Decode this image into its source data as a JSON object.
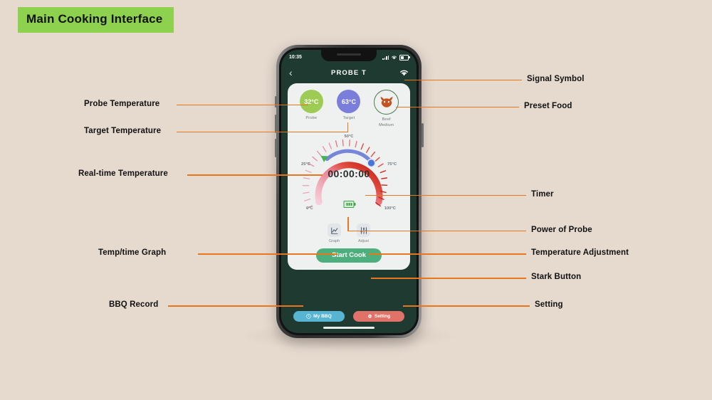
{
  "banner": {
    "title": "Main Cooking Interface",
    "bg": "#8ed14f"
  },
  "phone": {
    "status": {
      "time": "10:35",
      "signal_icon": "cellular-bars-icon",
      "wifi_icon": "wifi-icon",
      "battery_icon": "battery-icon"
    },
    "nav": {
      "back_icon": "chevron-left-icon",
      "title": "PROBE T",
      "wifi_icon": "wifi-icon"
    },
    "readouts": [
      {
        "value": "32°C",
        "label": "Probe",
        "color": "#9dcb53",
        "name": "probe-temperature"
      },
      {
        "value": "63°C",
        "label": "Target",
        "color": "#7b7ddb",
        "name": "target-temperature"
      },
      {
        "value": "",
        "label": "Beef\nMedium",
        "label_line1": "Beef",
        "label_line2": "Medium",
        "icon": "bull-head-icon",
        "color": "#c2521f",
        "name": "preset-food"
      }
    ],
    "gauge": {
      "timer": "00:00:00",
      "ticks": [
        "0°C",
        "25°C",
        "50°C",
        "75°C",
        "100°C"
      ],
      "min": 0,
      "max": 100,
      "unit": "°C",
      "probe_marker_value": 32,
      "target_marker_value": 63,
      "probe_marker_color": "#4caf50",
      "target_marker_color": "#4a74d8",
      "arc_start_color": "#f3c6d3",
      "arc_end_color": "#d42d20",
      "probe_battery_icon": "battery-icon"
    },
    "actions": [
      {
        "label": "Graph",
        "icon": "line-chart-icon",
        "name": "graph-button"
      },
      {
        "label": "Adjust",
        "icon": "sliders-icon",
        "name": "adjust-button"
      }
    ],
    "start_button": {
      "label": "Start Cook",
      "color": "#4caf7d"
    },
    "bottom_buttons": [
      {
        "label": "My BBQ",
        "icon": "clock-icon",
        "color": "#58b4d3",
        "name": "my-bbq-button"
      },
      {
        "label": "Setting",
        "icon": "gear-icon",
        "color": "#e0726a",
        "name": "setting-button"
      }
    ]
  },
  "annotations": {
    "left": [
      {
        "label": "Probe Temperature"
      },
      {
        "label": "Target Temperature"
      },
      {
        "label": "Real-time Temperature"
      },
      {
        "label": "Temp/time Graph"
      },
      {
        "label": "BBQ Record"
      }
    ],
    "right": [
      {
        "label": "Signal Symbol"
      },
      {
        "label": "Preset Food"
      },
      {
        "label": "Timer"
      },
      {
        "label": "Power of Probe"
      },
      {
        "label": "Temperature Adjustment"
      },
      {
        "label": "Stark Button"
      },
      {
        "label": "Setting"
      }
    ],
    "line_color": "#e8761e"
  }
}
